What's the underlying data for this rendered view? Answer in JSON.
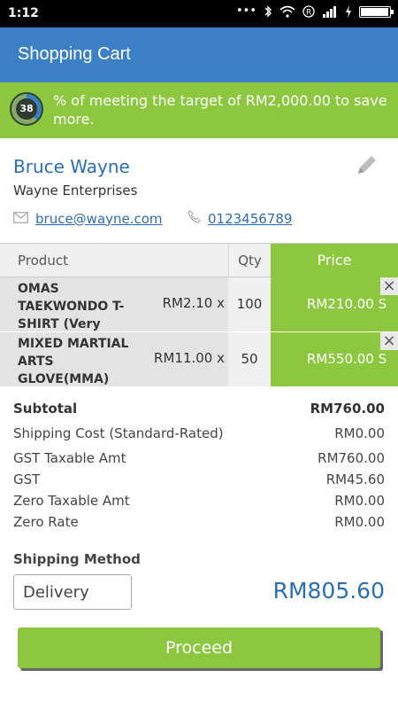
{
  "status": {
    "time": "1:12",
    "icons": [
      "dots-icon",
      "bluetooth-icon",
      "wifi-icon",
      "registered-icon",
      "signal-icon",
      "charging-icon",
      "battery-icon"
    ]
  },
  "header": {
    "title": "Shopping Cart"
  },
  "banner": {
    "progress_value": "38",
    "progress_fraction": 0.38,
    "message": "% of meeting the target of RM2,000.00 to save more."
  },
  "customer": {
    "name": "Bruce Wayne",
    "company": "Wayne Enterprises",
    "email": "bruce@wayne.com",
    "phone": "0123456789"
  },
  "table": {
    "headers": {
      "product": "Product",
      "qty": "Qty",
      "price": "Price"
    },
    "rows": [
      {
        "product": "OMAS TAEKWONDO T-SHIRT (Very",
        "unit": "RM2.10 x",
        "qty": "100",
        "price": "RM210.00 S"
      },
      {
        "product": "MIXED MARTIAL ARTS GLOVE(MMA)",
        "unit": "RM11.00 x",
        "qty": "50",
        "price": "RM550.00 S"
      }
    ]
  },
  "summary": {
    "subtotal": {
      "label": "Subtotal",
      "value": "RM760.00"
    },
    "shipping": {
      "label": "Shipping Cost (Standard-Rated)",
      "value": "RM0.00"
    },
    "gst_taxable": {
      "label": "GST Taxable Amt",
      "value": "RM760.00"
    },
    "gst": {
      "label": "GST",
      "value": "RM45.60"
    },
    "zero_taxable": {
      "label": "Zero Taxable Amt",
      "value": "RM0.00"
    },
    "zero_rate": {
      "label": "Zero Rate",
      "value": "RM0.00"
    }
  },
  "shipping_method": {
    "label": "Shipping Method",
    "selected": "Delivery"
  },
  "total": "RM805.60",
  "actions": {
    "proceed": "Proceed"
  },
  "colors": {
    "primary": "#3b7fc4",
    "accent": "#8dc63f",
    "link": "#2a6fb3"
  }
}
